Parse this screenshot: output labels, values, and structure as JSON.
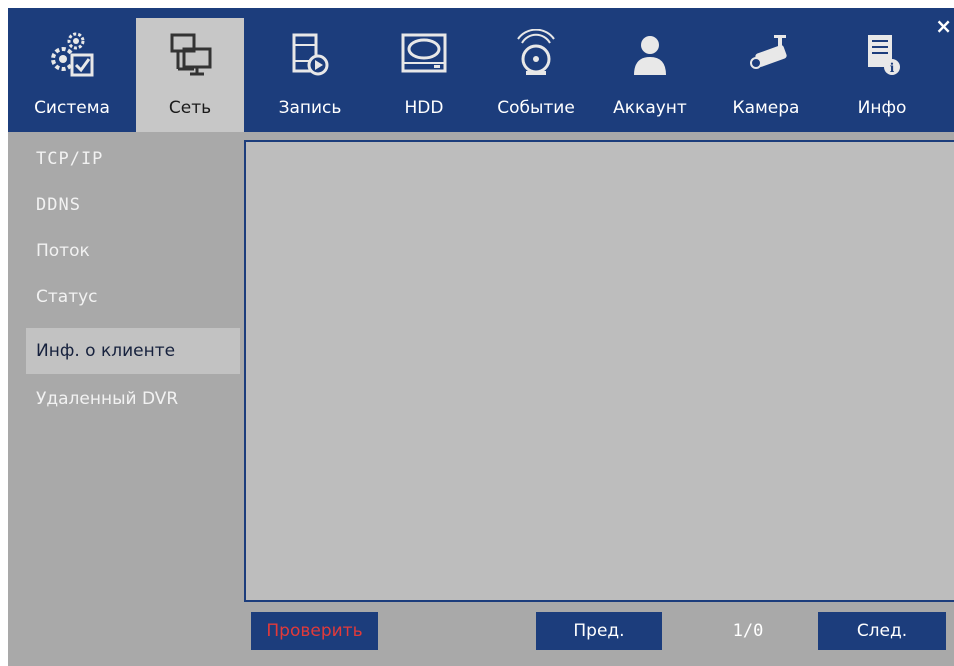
{
  "tabs": [
    {
      "label": "Система",
      "icon": "system-gears-icon"
    },
    {
      "label": "Сеть",
      "icon": "network-icon"
    },
    {
      "label": "Запись",
      "icon": "record-film-icon"
    },
    {
      "label": "HDD",
      "icon": "hdd-icon"
    },
    {
      "label": "Событие",
      "icon": "event-alarm-icon"
    },
    {
      "label": "Аккаунт",
      "icon": "account-user-icon"
    },
    {
      "label": "Камера",
      "icon": "camera-icon"
    },
    {
      "label": "Инфо",
      "icon": "info-document-icon"
    }
  ],
  "active_tab": "Сеть",
  "close_symbol": "×",
  "sidebar": {
    "items": [
      {
        "label": "TCP/IP"
      },
      {
        "label": "DDNS"
      },
      {
        "label": "Поток"
      },
      {
        "label": "Статус"
      },
      {
        "label": "Инф. о клиенте"
      },
      {
        "label": "Удаленный DVR"
      }
    ],
    "active": "Инф. о клиенте"
  },
  "footer": {
    "check_label": "Проверить",
    "prev_label": "Пред.",
    "page_indicator": "1/0",
    "next_label": "След."
  },
  "colors": {
    "header_bg": "#1c3d7c",
    "body_bg": "#a9a9a9",
    "active_tab_bg": "#c7c7c7",
    "panel_bg": "#bdbdbd",
    "check_text": "#e23a3a"
  }
}
